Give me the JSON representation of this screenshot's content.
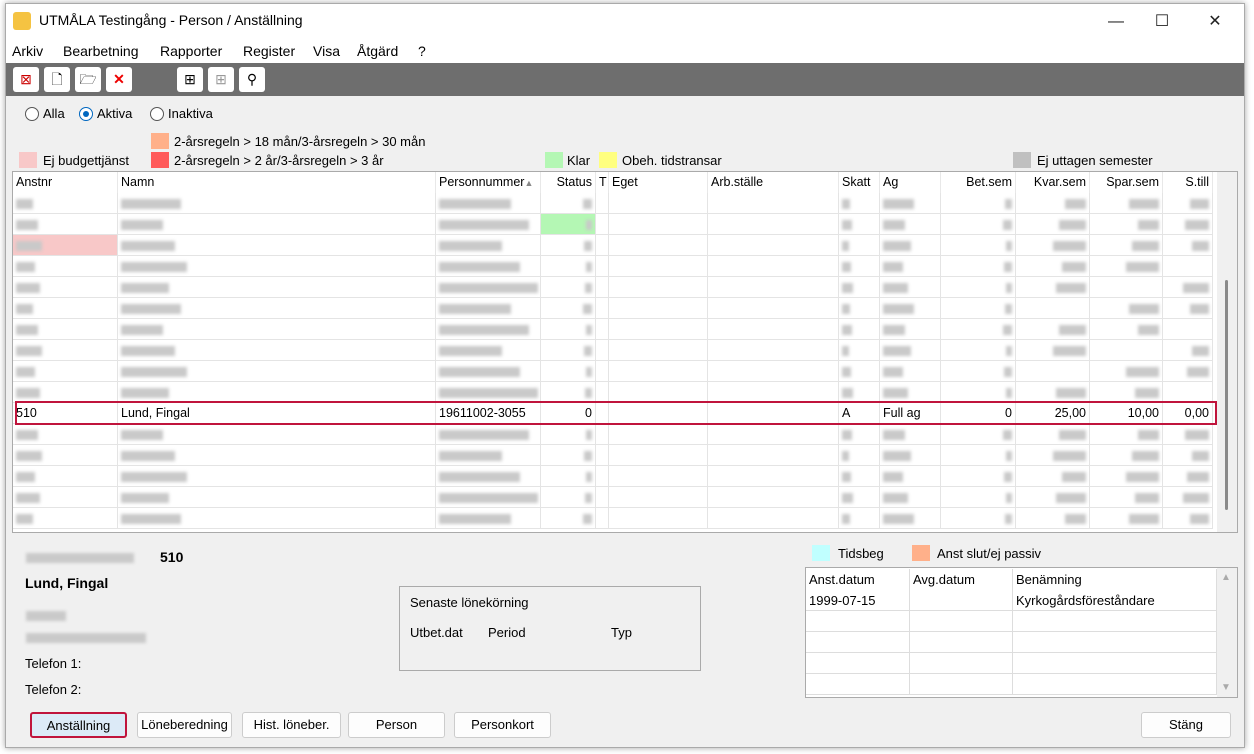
{
  "window": {
    "title": "UTMÅLA Testingång - Person / Anställning",
    "minimize": "—",
    "maximize": "☐",
    "close": "✕"
  },
  "menu": [
    "Arkiv",
    "Bearbetning",
    "Rapporter",
    "Register",
    "Visa",
    "Åtgärd",
    "?"
  ],
  "toolbar": {
    "icons": [
      "delete-record-icon",
      "new-document-icon",
      "open-folder-icon",
      "cancel-icon",
      "grid-view-icon",
      "grid-view-disabled-icon",
      "binoculars-icon"
    ]
  },
  "filter": {
    "options": [
      "Alla",
      "Aktiva",
      "Inaktiva"
    ],
    "selected": "Aktiva"
  },
  "legend": {
    "ej_budget": "Ej budgettjänst",
    "regel18": "2-årsregeln > 18 mån/3-årsregeln > 30 mån",
    "regel2": "2-årsregeln > 2 år/3-årsregeln > 3 år",
    "klar": "Klar",
    "obeh": "Obeh. tidstransar",
    "ej_uttagen": "Ej uttagen semester",
    "tidsbeg": "Tidsbeg",
    "anst_slut": "Anst slut/ej passiv"
  },
  "colors": {
    "ej_budget": "#f8c8c8",
    "regel18": "#ffb08a",
    "regel2": "#ff5a5a",
    "klar": "#b4f7b4",
    "obeh": "#ffff80",
    "ej_uttagen": "#c0c0c0",
    "tidsbeg": "#c0ffff",
    "anst_slut": "#ffb08a",
    "selection": "#c0143c"
  },
  "table": {
    "columns": [
      "Anstnr",
      "Namn",
      "Personnummer",
      "Status",
      "T",
      "Eget",
      "Arb.ställe",
      "Skatt",
      "Ag",
      "Bet.sem",
      "Kvar.sem",
      "Spar.sem",
      "S.till"
    ],
    "sort_indicator": "▲",
    "selected_row": {
      "anstnr": "510",
      "namn": "Lund, Fingal",
      "personnummer": "19611002-3055",
      "status": "0",
      "t": "",
      "eget": "",
      "arb": "",
      "skatt": "A",
      "ag": "Full ag",
      "betsem": "0",
      "kvarsem": "25,00",
      "sparsem": "10,00",
      "still": "0,00"
    }
  },
  "person": {
    "anstnr": "510",
    "name": "Lund, Fingal",
    "tel1": "Telefon 1:",
    "tel2": "Telefon 2:"
  },
  "lonekorning": {
    "title": "Senaste lönekörning",
    "cols": [
      "Utbet.dat",
      "Period",
      "Typ"
    ]
  },
  "employment": {
    "cols": [
      "Anst.datum",
      "Avg.datum",
      "Benämning"
    ],
    "rows": [
      [
        "1999-07-15",
        "",
        "Kyrkogårdsföreståndare"
      ]
    ]
  },
  "buttons": [
    "Anställning",
    "Löneberedning",
    "Hist. löneber.",
    "Person",
    "Personkort"
  ],
  "close_button": "Stäng"
}
